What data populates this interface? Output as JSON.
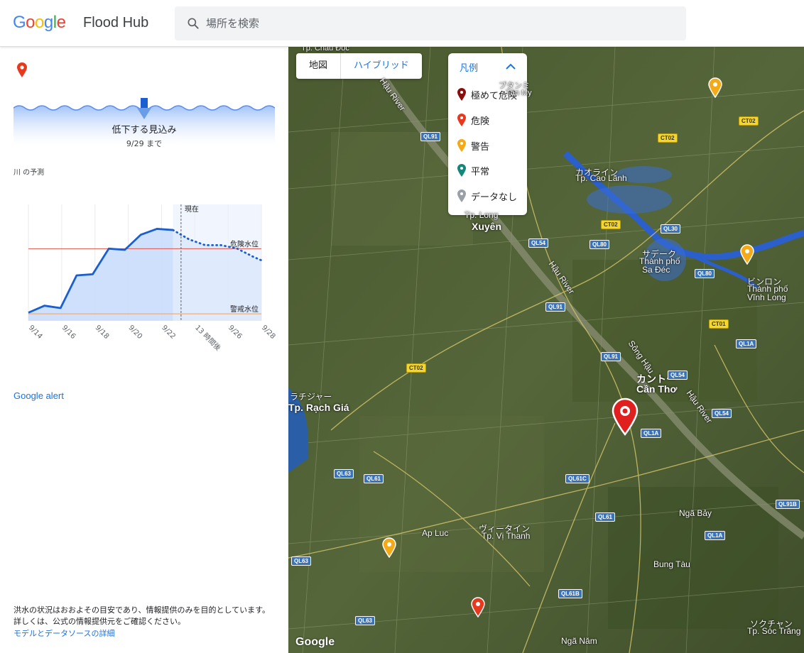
{
  "header": {
    "logo_letters": [
      {
        "ch": "G",
        "color": "#4285f4"
      },
      {
        "ch": "o",
        "color": "#ea4335"
      },
      {
        "ch": "o",
        "color": "#fbbc05"
      },
      {
        "ch": "g",
        "color": "#4285f4"
      },
      {
        "ch": "l",
        "color": "#34a853"
      },
      {
        "ch": "e",
        "color": "#ea4335"
      }
    ],
    "product": "Flood Hub",
    "search_placeholder": "場所を検索"
  },
  "panel": {
    "trend": "低下する見込み",
    "trend_until": "9/29 まで",
    "forecast_label": "川 の予測",
    "alert_link": "Google alert",
    "disclaimer": "洪水の状況はおおよその目安であり、情報提供のみを目的としています。詳しくは、公式の情報提供元をご確認ください。",
    "details_link": "モデルとデータソースの詳細"
  },
  "chart_data": {
    "type": "line",
    "x_ticks": [
      "9/14",
      "9/16",
      "9/18",
      "9/20",
      "9/22",
      "13 時間後",
      "9/26",
      "9/28"
    ],
    "now_label": "現在",
    "thresholds": [
      {
        "name": "危険水位",
        "value": 0.62,
        "color": "#e0584a"
      },
      {
        "name": "警戒水位",
        "value": 0.06,
        "color": "#f0a058"
      }
    ],
    "observed": [
      {
        "x": 0,
        "y": 0.07
      },
      {
        "x": 1,
        "y": 0.13
      },
      {
        "x": 2,
        "y": 0.11
      },
      {
        "x": 3,
        "y": 0.39
      },
      {
        "x": 4,
        "y": 0.4
      },
      {
        "x": 5,
        "y": 0.62
      },
      {
        "x": 6,
        "y": 0.61
      },
      {
        "x": 7,
        "y": 0.74
      },
      {
        "x": 8,
        "y": 0.79
      },
      {
        "x": 9,
        "y": 0.78
      }
    ],
    "forecast": [
      {
        "x": 9,
        "y": 0.78
      },
      {
        "x": 10,
        "y": 0.7
      },
      {
        "x": 11,
        "y": 0.65
      },
      {
        "x": 12,
        "y": 0.65
      },
      {
        "x": 13,
        "y": 0.62
      },
      {
        "x": 14,
        "y": 0.55
      },
      {
        "x": 14.5,
        "y": 0.52
      }
    ],
    "xlim": [
      0,
      14.5
    ],
    "ylim": [
      0,
      1
    ]
  },
  "map": {
    "maptypes": [
      "地図",
      "ハイブリッド"
    ],
    "legend": {
      "title": "凡例",
      "items": [
        {
          "label": "極めて危険",
          "color": "#8b0e0e"
        },
        {
          "label": "危険",
          "color": "#e8391f"
        },
        {
          "label": "警告",
          "color": "#f4a916"
        },
        {
          "label": "平常",
          "color": "#12877a"
        },
        {
          "label": "データなし",
          "color": "#9aa0a6"
        }
      ]
    },
    "place_labels": [
      {
        "text": "Tp. Châu Đốc",
        "cls": "small"
      },
      {
        "text": "プタンミ",
        "cls": "small"
      },
      {
        "text": "Tân My",
        "cls": "small"
      },
      {
        "text": "カオライン",
        "cls": "mid"
      },
      {
        "text": "Tp. Cao Lãnh",
        "cls": "mid"
      },
      {
        "text": "Tp. Long",
        "cls": "mid"
      },
      {
        "text": "Xuyên",
        "cls": "big"
      },
      {
        "text": "サデーク",
        "cls": "mid"
      },
      {
        "text": "Thành phố",
        "cls": "mid"
      },
      {
        "text": "Sa Đéc",
        "cls": "mid"
      },
      {
        "text": "ビンロン",
        "cls": "mid"
      },
      {
        "text": "Thành phố",
        "cls": "mid"
      },
      {
        "text": "Vĩnh Long",
        "cls": "mid"
      },
      {
        "text": "Hậu River",
        "cls": "mid"
      },
      {
        "text": "Sông Hậu",
        "cls": "mid"
      },
      {
        "text": "Hậu River",
        "cls": "mid"
      },
      {
        "text": "Hậu River",
        "cls": "mid"
      },
      {
        "text": "カントー",
        "cls": "big"
      },
      {
        "text": "Cần Thơ",
        "cls": "big"
      },
      {
        "text": "ラチジャー",
        "cls": "mid"
      },
      {
        "text": "Tp. Rạch Giá",
        "cls": "big"
      },
      {
        "text": "Ngã Bảy",
        "cls": "mid"
      },
      {
        "text": "Ap Luc",
        "cls": "mid"
      },
      {
        "text": "ヴィータイン",
        "cls": "mid"
      },
      {
        "text": "Tp. Vị Thanh",
        "cls": "mid"
      },
      {
        "text": "Bung Tàu",
        "cls": "mid"
      },
      {
        "text": "ソクチャン",
        "cls": "mid"
      },
      {
        "text": "Tp. Sóc Trăng",
        "cls": "mid"
      },
      {
        "text": "Ngã Năm",
        "cls": "mid"
      }
    ],
    "road_shields": [
      {
        "text": "QL91",
        "kind": "blue"
      },
      {
        "text": "CT02",
        "kind": "yellow"
      },
      {
        "text": "CT02",
        "kind": "yellow"
      },
      {
        "text": "CT02",
        "kind": "yellow"
      },
      {
        "text": "QL30",
        "kind": "blue"
      },
      {
        "text": "QL54",
        "kind": "blue"
      },
      {
        "text": "QL80",
        "kind": "blue"
      },
      {
        "text": "QL80",
        "kind": "blue"
      },
      {
        "text": "QL91",
        "kind": "blue"
      },
      {
        "text": "CT01",
        "kind": "yellow"
      },
      {
        "text": "QL1A",
        "kind": "blue"
      },
      {
        "text": "QL91",
        "kind": "blue"
      },
      {
        "text": "QL54",
        "kind": "blue"
      },
      {
        "text": "CT02",
        "kind": "yellow"
      },
      {
        "text": "QL54",
        "kind": "blue"
      },
      {
        "text": "QL1A",
        "kind": "blue"
      },
      {
        "text": "QL63",
        "kind": "blue"
      },
      {
        "text": "QL61",
        "kind": "blue"
      },
      {
        "text": "QL61C",
        "kind": "blue"
      },
      {
        "text": "QL91B",
        "kind": "blue"
      },
      {
        "text": "QL61",
        "kind": "blue"
      },
      {
        "text": "QL1A",
        "kind": "blue"
      },
      {
        "text": "QL63",
        "kind": "blue"
      },
      {
        "text": "QL61B",
        "kind": "blue"
      },
      {
        "text": "QL63",
        "kind": "blue"
      }
    ],
    "attribution": "Google"
  }
}
